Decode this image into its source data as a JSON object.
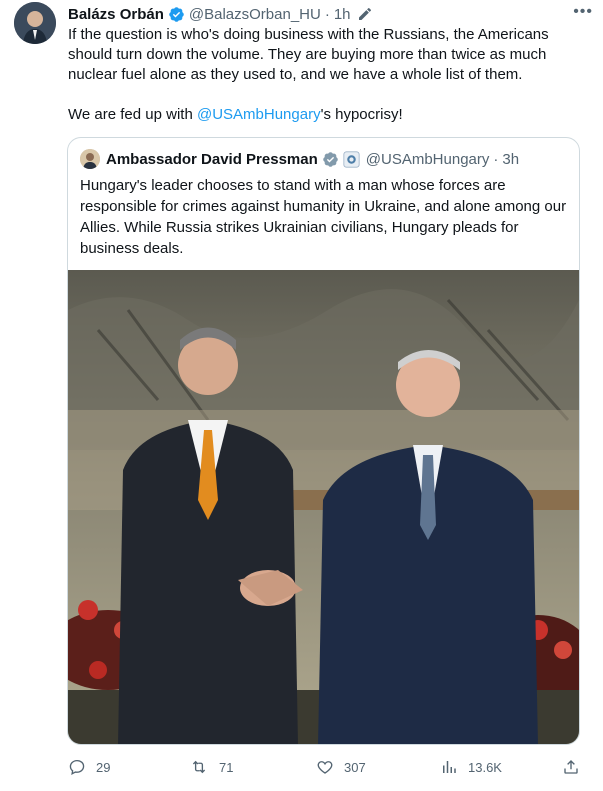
{
  "tweet": {
    "author_name": "Balázs Orbán",
    "author_handle": "@BalazsOrban_HU",
    "separator": "·",
    "time": "1h",
    "paragraph1": "If the question is who's doing business with the Russians, the Americans should turn down the volume. They are buying more than twice as much nuclear fuel alone as they used to, and we have a whole list of them.",
    "p2_before": "We are fed up with ",
    "p2_mention": "@USAmbHungary",
    "p2_after": "'s hypocrisy!"
  },
  "quote": {
    "author_name": "Ambassador David Pressman",
    "author_handle": "@USAmbHungary",
    "separator": "·",
    "time": "3h",
    "text": "Hungary's leader chooses to stand with a man whose forces are responsible for crimes against humanity in Ukraine, and alone among our Allies. While Russia strikes Ukrainian civilians, Hungary pleads for business deals."
  },
  "actions": {
    "replies": "29",
    "retweets": "71",
    "likes": "307",
    "views": "13.6K"
  },
  "colors": {
    "accent": "#1d9bf0",
    "secondary_text": "#536471",
    "border": "#cfd9de"
  }
}
